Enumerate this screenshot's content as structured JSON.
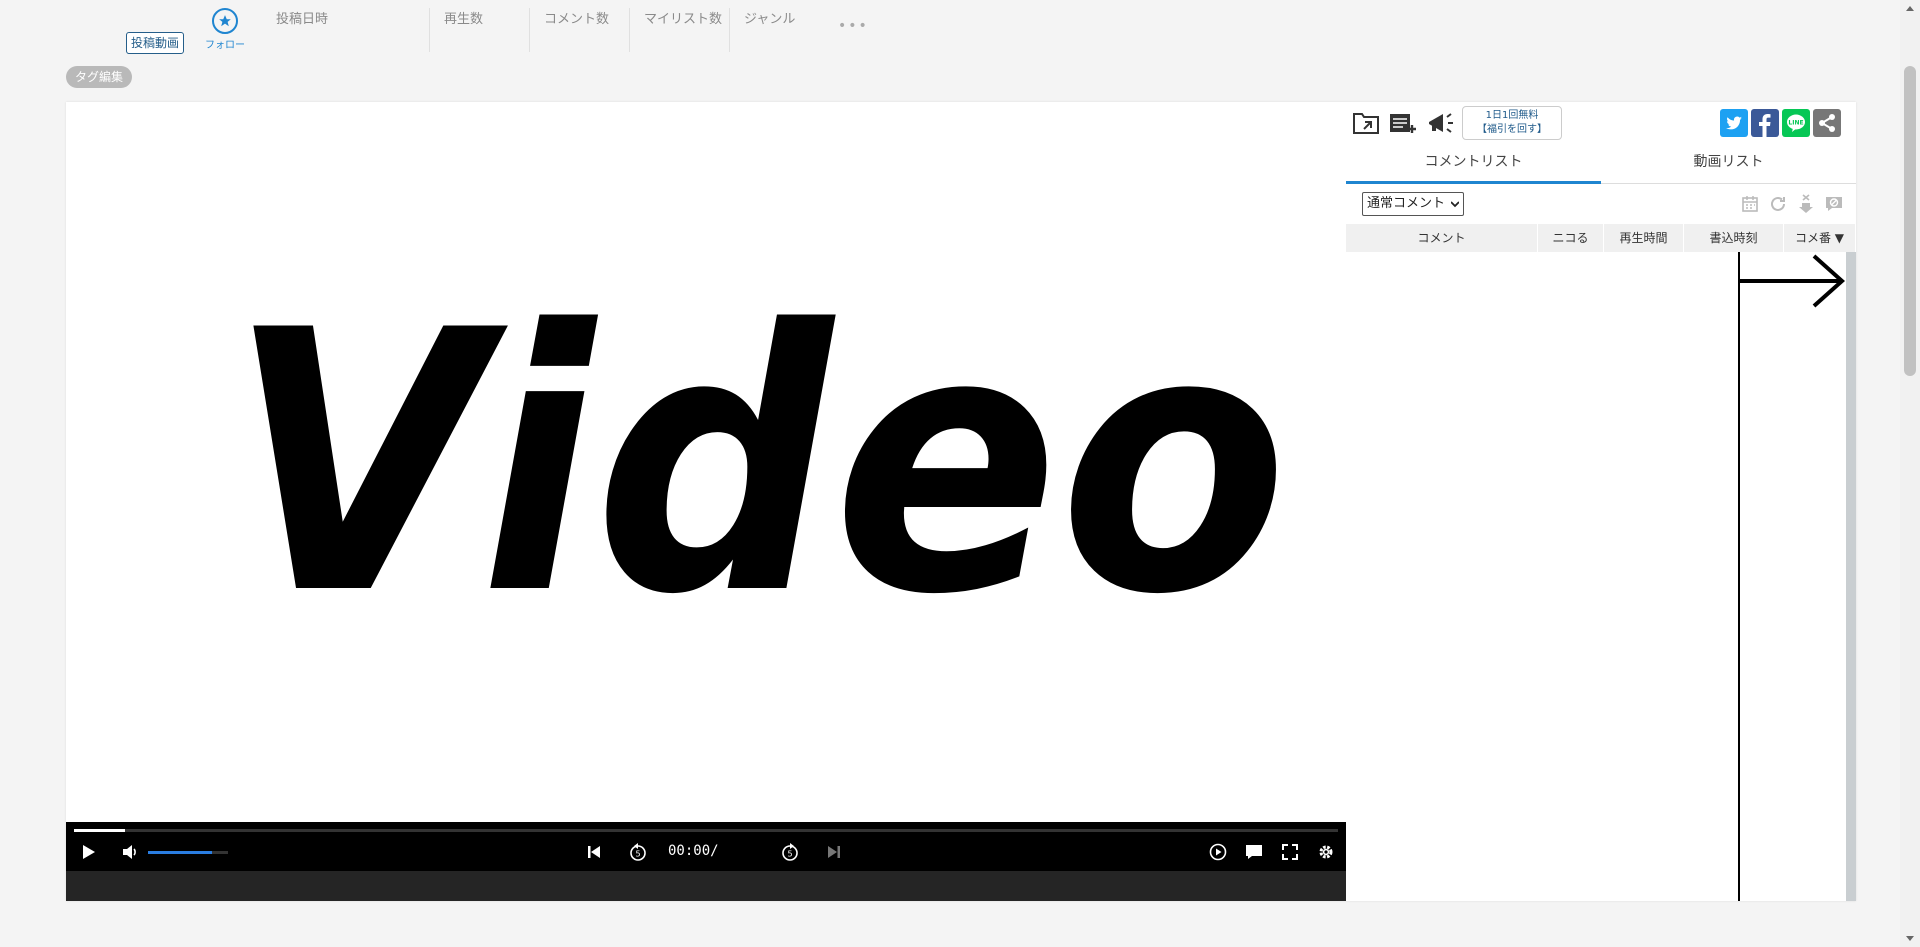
{
  "header": {
    "video_badge": "投稿動画",
    "follow_label": "フォロー",
    "stats": [
      "投稿日時",
      "再生数",
      "コメント数",
      "マイリスト数",
      "ジャンル"
    ],
    "more_label": "•••"
  },
  "tag_edit_label": "タグ編集",
  "video": {
    "title_text": "Video",
    "time_display": "00:00/",
    "seek_progress": 0.04,
    "volume_level": 0.8
  },
  "right_panel": {
    "ad_line1": "1日1回無料",
    "ad_line2": "【福引を回す】",
    "tabs": [
      {
        "label": "コメントリスト",
        "active": true
      },
      {
        "label": "動画リスト",
        "active": false
      }
    ],
    "filter_value": "通常コメント",
    "columns": [
      "コメント",
      "ニコる",
      "再生時間",
      "書込時刻",
      "コメ番 ▼"
    ]
  },
  "colors": {
    "accent": "#1f85d0",
    "twitter": "#1da1f2",
    "facebook": "#3b5998",
    "line": "#06c755",
    "share": "#777777"
  }
}
